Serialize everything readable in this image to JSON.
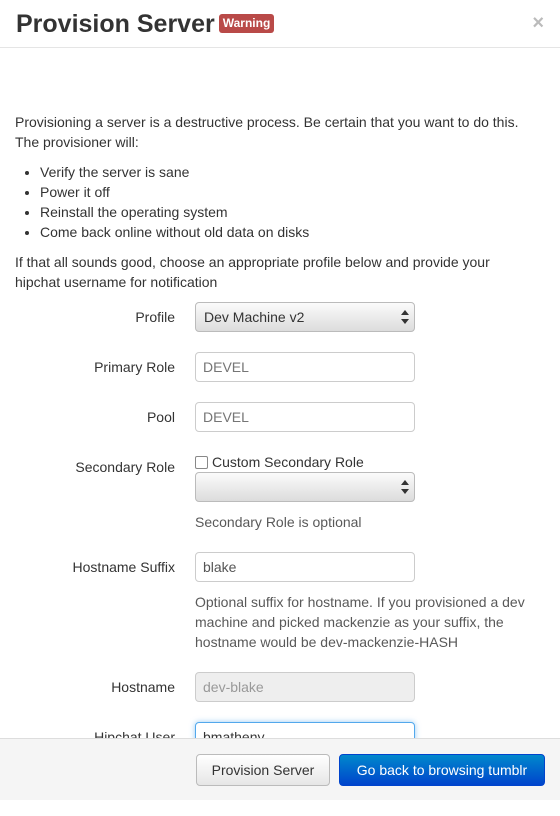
{
  "header": {
    "title": "Provision Server",
    "badge": "Warning",
    "close": "×"
  },
  "intro": {
    "text": "Provisioning a server is a destructive process. Be certain that you want to do this. The provisioner will:",
    "steps": [
      "Verify the server is sane",
      "Power it off",
      "Reinstall the operating system",
      "Come back online without old data on disks"
    ],
    "followup": "If that all sounds good, choose an appropriate profile below and provide your hipchat username for notification"
  },
  "form": {
    "profile": {
      "label": "Profile",
      "value": "Dev Machine v2"
    },
    "primary_role": {
      "label": "Primary Role",
      "placeholder": "DEVEL"
    },
    "pool": {
      "label": "Pool",
      "placeholder": "DEVEL"
    },
    "secondary_role": {
      "label": "Secondary Role",
      "checkbox_label": "Custom Secondary Role",
      "checked": false,
      "value": "",
      "help": "Secondary Role is optional"
    },
    "hostname_suffix": {
      "label": "Hostname Suffix",
      "value": "blake",
      "help": "Optional suffix for hostname. If you provisioned a dev machine and picked mackenzie as your suffix, the hostname would be dev-mackenzie-HASH"
    },
    "hostname": {
      "label": "Hostname",
      "value": "dev-blake"
    },
    "hipchat_user": {
      "label": "Hipchat User",
      "value": "bmatheny"
    }
  },
  "footer": {
    "provision_label": "Provision Server",
    "back_label": "Go back to browsing tumblr"
  },
  "colors": {
    "badge": "#b94a48",
    "primary": "#0055cc",
    "focus": "#52a8ec"
  }
}
